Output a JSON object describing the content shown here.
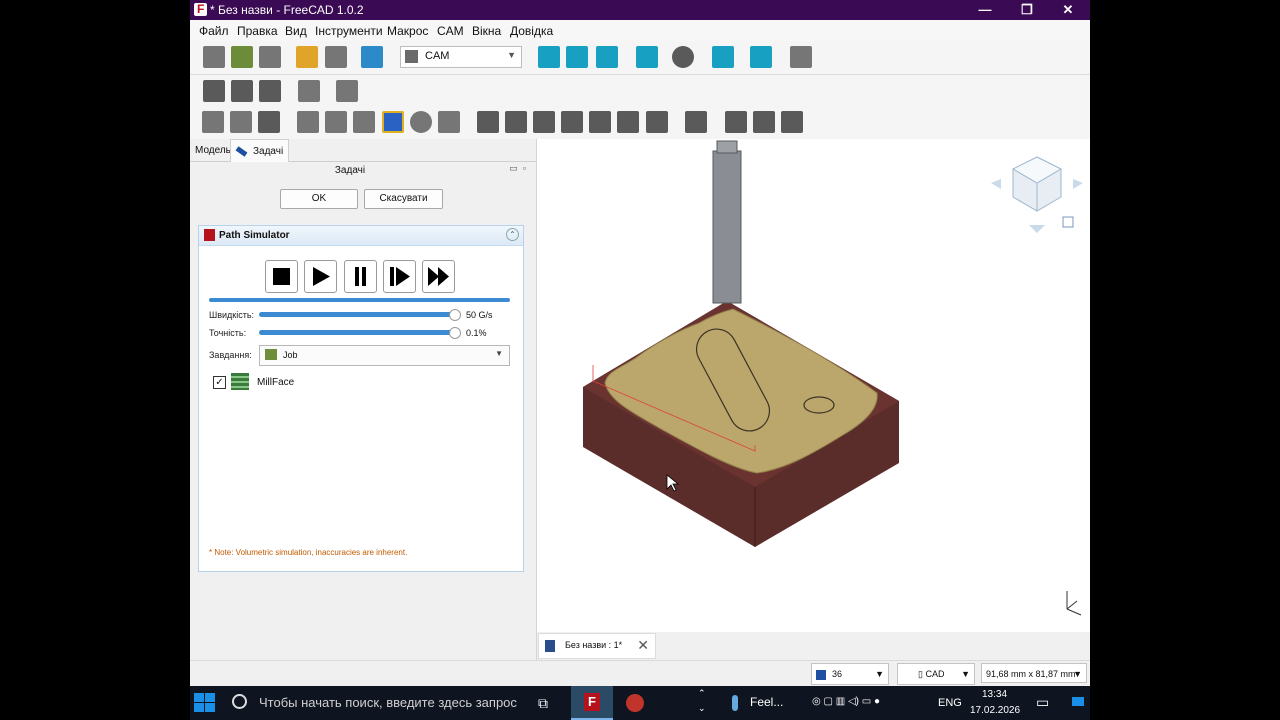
{
  "window": {
    "title": "* Без назви - FreeCAD 1.0.2",
    "controls": [
      "—",
      "❐",
      "✕"
    ]
  },
  "menu": [
    "Файл",
    "Правка",
    "Вид",
    "Інструменти",
    "Макрос",
    "CAM",
    "Вікна",
    "Довідка"
  ],
  "toolbar": {
    "workbench": "CAM"
  },
  "panel": {
    "tabs": [
      "Модель",
      "Задачі"
    ],
    "active_tab": "Задачі",
    "title": "Задачі",
    "ok_label": "OK",
    "cancel_label": "Скасувати"
  },
  "simulator": {
    "title": "Path Simulator",
    "progress_fraction": 1.0,
    "speed_label": "Швидкість:",
    "speed_value": "50 G/s",
    "accuracy_label": "Точність:",
    "accuracy_value": "0.1%",
    "job_label": "Завдання:",
    "job_value": "Job",
    "operation_name": "MillFace",
    "operation_checked": true,
    "note": "* Note: Volumetric simulation, inaccuracies are inherent."
  },
  "viewport": {
    "stock_color": "#5a2d2b",
    "surface_color": "#bba66b",
    "tool_color": "#8a8e94"
  },
  "document_tab": {
    "label": "Без назви : 1*"
  },
  "statusbar": {
    "counter": "36",
    "nav_style": "CAD",
    "dimensions": "91,68 mm x 81,87 mm"
  },
  "taskbar": {
    "search_placeholder": "Чтобы начать поиск, введите здесь запрос",
    "app_label": "Feel...",
    "language": "ENG",
    "time": "13:34",
    "date": "17.02.2026"
  }
}
